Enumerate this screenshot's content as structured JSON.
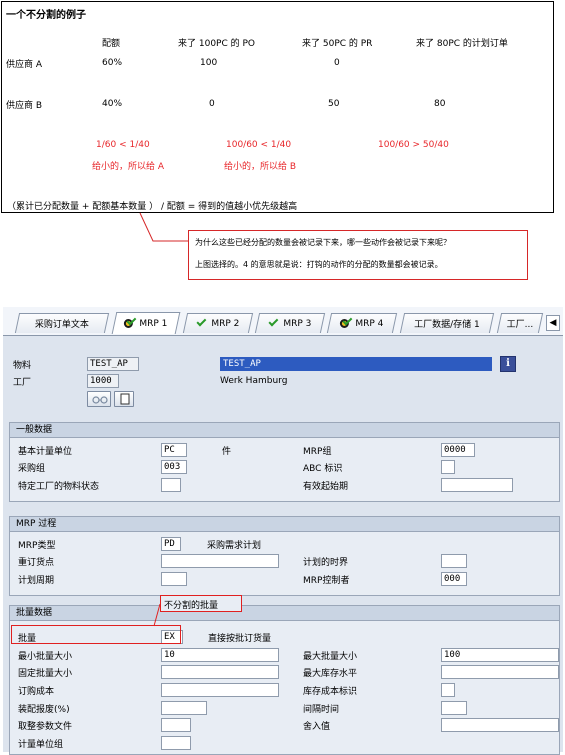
{
  "example": {
    "title": "一个不分割的例子",
    "headers": [
      "配额",
      "来了 100PC 的 PO",
      "来了 50PC 的 PR",
      "来了 80PC 的计划订单"
    ],
    "rows": [
      {
        "label": "供应商 A",
        "quota": "60%",
        "po": "100",
        "pr": "0",
        "plan": ""
      },
      {
        "label": "供应商 B",
        "quota": "40%",
        "po": "0",
        "pr": "50",
        "plan": "80"
      }
    ],
    "calc": [
      "1/60 < 1/40",
      "100/60 < 1/40",
      "100/60 > 50/40"
    ],
    "result": [
      "给小的，所以给 A",
      "给小的，所以给 B"
    ],
    "formula": "（累计已分配数量 + 配额基本数量 ） / 配额 = 得到的值越小优先级越高"
  },
  "callout": {
    "line1": "为什么这些已经分配的数量会被记录下来，哪一些动作会被记录下来呢？",
    "line2": "上图选择的。4 的意思就是说：打钩的动作的分配的数量都会被记录。"
  },
  "tabs": [
    {
      "label": "采购订单文本",
      "icon": ""
    },
    {
      "label": "MRP 1",
      "icon": "target-icon"
    },
    {
      "label": "MRP 2",
      "icon": "check-icon"
    },
    {
      "label": "MRP 3",
      "icon": "check-icon"
    },
    {
      "label": "MRP 4",
      "icon": "target-icon"
    },
    {
      "label": "工厂数据/存储 1",
      "icon": ""
    },
    {
      "label": "工厂...",
      "icon": ""
    }
  ],
  "header": {
    "material_label": "物料",
    "material_value": "TEST_AP",
    "material_desc": "TEST_AP",
    "plant_label": "工厂",
    "plant_value": "1000",
    "plant_name": "Werk Hamburg"
  },
  "general": {
    "title": "一般数据",
    "base_uom_label": "基本计量单位",
    "base_uom": "PC",
    "base_uom_text": "件",
    "mrp_group_label": "MRP组",
    "mrp_group": "0000",
    "purch_group_label": "采购组",
    "purch_group": "003",
    "abc_label": "ABC 标识",
    "abc": "",
    "plant_status_label": "特定工厂的物料状态",
    "plant_status": "",
    "valid_from_label": "有效起始期",
    "valid_from": ""
  },
  "mrp_proc": {
    "title": "MRP 过程",
    "mrp_type_label": "MRP类型",
    "mrp_type": "PD",
    "mrp_type_text": "采购需求计划",
    "reorder_label": "重订货点",
    "reorder": "",
    "time_fence_label": "计划的时界",
    "time_fence": "",
    "cycle_label": "计划周期",
    "cycle": "",
    "controller_label": "MRP控制者",
    "controller": "000"
  },
  "lot": {
    "title": "批量数据",
    "annotation": "不分割的批量",
    "lot_size_label": "批量",
    "lot_size": "EX",
    "lot_size_text": "直接按批订货量",
    "min_label": "最小批量大小",
    "min": "10",
    "max_label": "最大批量大小",
    "max": "100",
    "fixed_label": "固定批量大小",
    "fixed": "",
    "max_stock_label": "最大库存水平",
    "max_stock": "",
    "order_cost_label": "订购成本",
    "order_cost": "",
    "storage_cost_label": "库存成本标识",
    "storage_cost": "",
    "scrap_label": "装配报废(%)",
    "scrap": "",
    "takt_label": "间隔时间",
    "takt": "",
    "rounding_profile_label": "取整参数文件",
    "rounding_profile": "",
    "rounding_value_label": "舍入值",
    "rounding_value": "",
    "uom_group_label": "计量单位组",
    "uom_group": ""
  },
  "colors": {
    "annotation_red": "#e8272b",
    "selection_blue": "#2d5bc0"
  }
}
